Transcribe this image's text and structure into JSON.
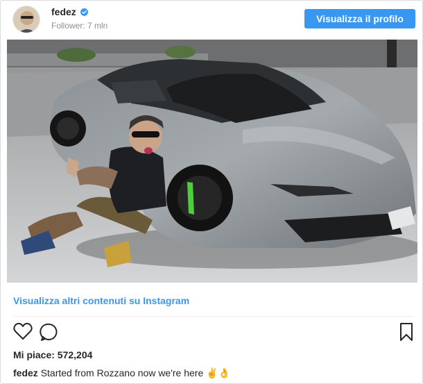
{
  "header": {
    "username": "fedez",
    "followers": "Follower: 7 mln",
    "view_profile_label": "Visualizza il profilo"
  },
  "post": {
    "more_link": "Visualizza altri contenuti su Instagram",
    "likes": "Mi piace: 572,204",
    "caption_user": "fedez",
    "caption_text": "Started from Rozzano now we're here ✌️👌"
  },
  "colors": {
    "accent": "#3897f0",
    "verified": "#3897f0",
    "text": "#262626",
    "muted": "#8e8e8e"
  },
  "icons": {
    "like": "heart-icon",
    "comment": "comment-icon",
    "save": "bookmark-icon",
    "verified": "verified-badge-icon"
  }
}
